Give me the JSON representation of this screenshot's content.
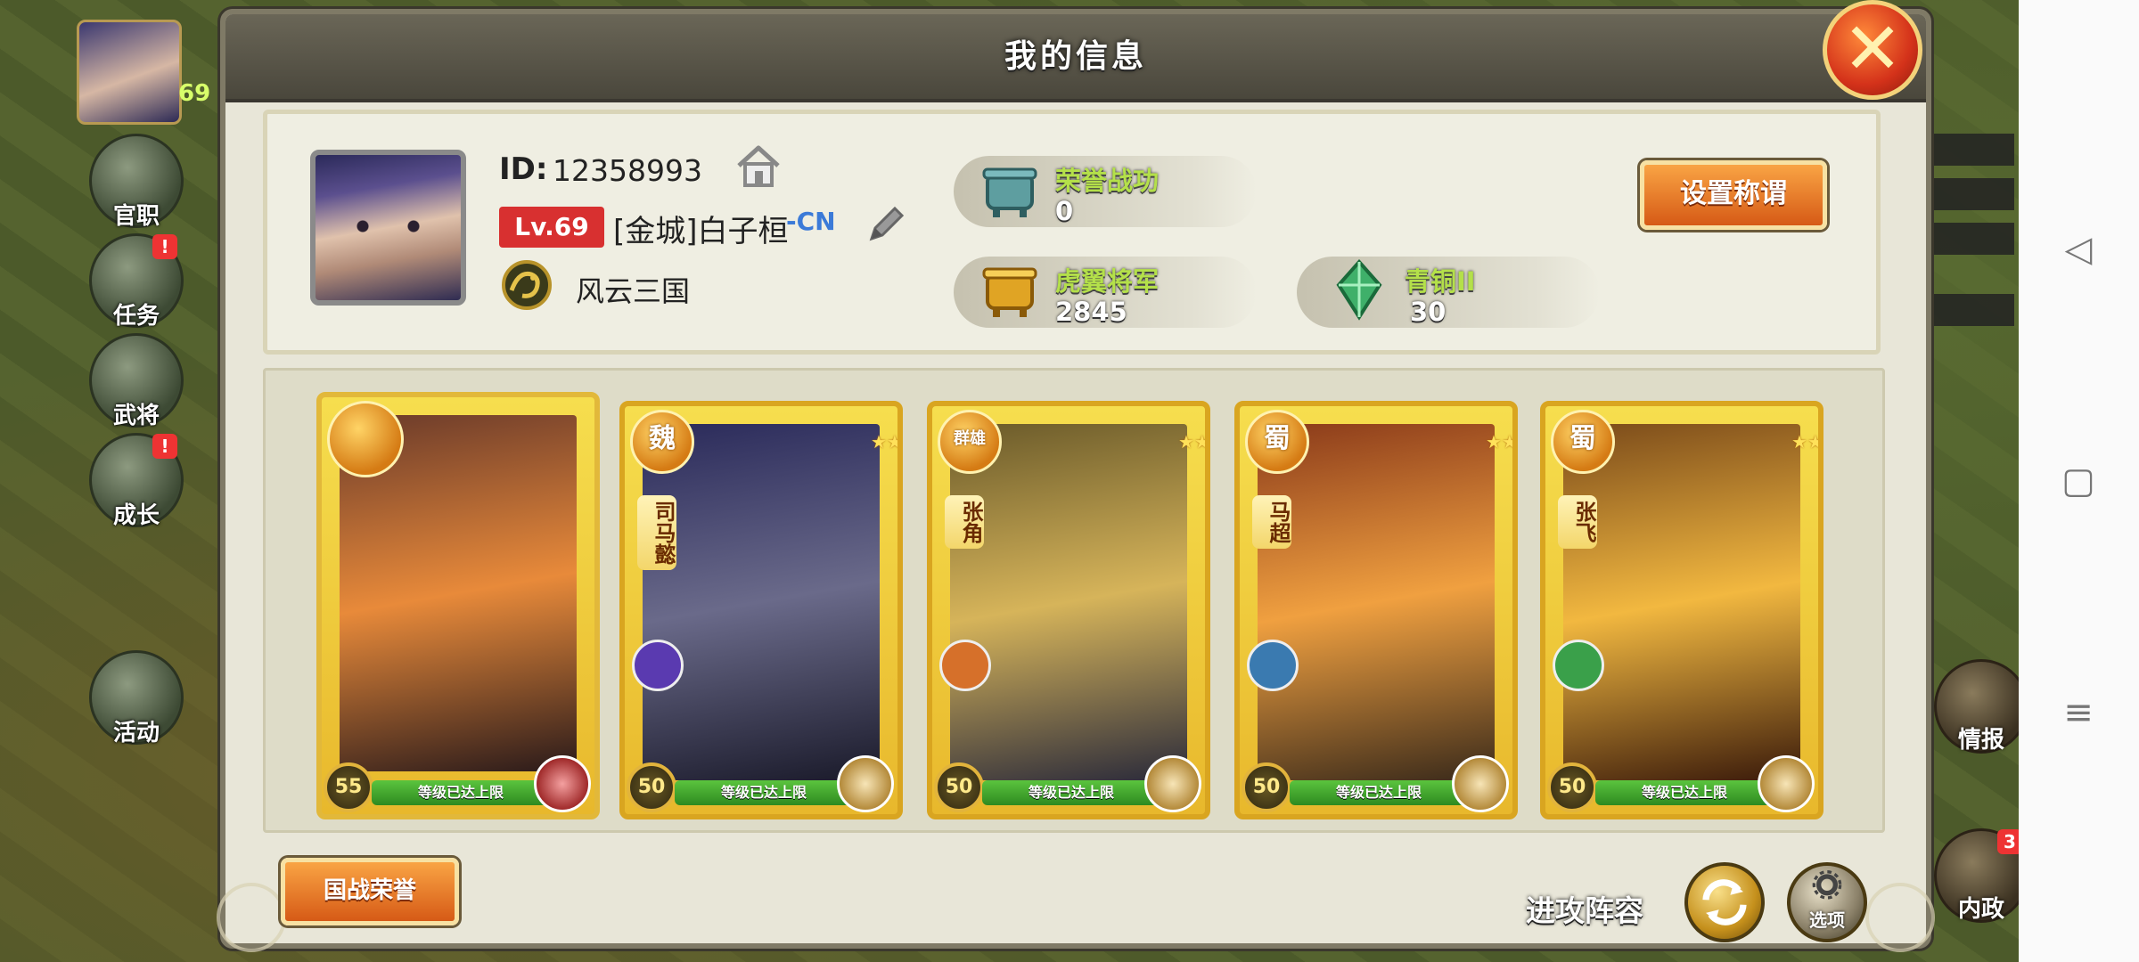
{
  "dialog": {
    "title": "我的信息",
    "close_icon": "close-x-icon"
  },
  "profile": {
    "id_label": "ID:",
    "id_value": "12358993",
    "level": "Lv.69",
    "name": "[金城]白子桓",
    "name_suffix": "-CN",
    "server": "风云三国"
  },
  "stats": {
    "honor_title": "荣誉战功",
    "honor_value": "0",
    "rank_title": "虎翼将军",
    "rank_value": "2845",
    "tier_title": "青铜II",
    "tier_value": "30"
  },
  "buttons": {
    "set_title": "设置称谓",
    "national_honor": "国战荣誉",
    "attack_lineup": "进攻阵容",
    "options": "选项"
  },
  "cards": [
    {
      "faction": "",
      "name": "",
      "level": "55",
      "status": "等级已达上限",
      "art": [
        "#6a3a2a",
        "#e88a3a",
        "#2a1a1a"
      ]
    },
    {
      "faction": "魏",
      "name": "司马懿",
      "level": "50",
      "status": "等级已达上限",
      "art": [
        "#2a2a5a",
        "#6a6a8a",
        "#1a1a2a"
      ]
    },
    {
      "faction": "群雄",
      "name": "张角",
      "level": "50",
      "status": "等级已达上限",
      "art": [
        "#6a5a2a",
        "#d6b45a",
        "#2a2a3a"
      ]
    },
    {
      "faction": "蜀",
      "name": "马超",
      "level": "50",
      "status": "等级已达上限",
      "art": [
        "#8a3a1a",
        "#f0a040",
        "#3a2a1a"
      ]
    },
    {
      "faction": "蜀",
      "name": "张飞",
      "level": "50",
      "status": "等级已达上限",
      "art": [
        "#7a4a1a",
        "#f2b840",
        "#3a1a0a"
      ]
    }
  ],
  "side_menu": {
    "level": "69",
    "items": [
      {
        "label": "官职",
        "badge": ""
      },
      {
        "label": "任务",
        "badge": "!"
      },
      {
        "label": "武将",
        "badge": ""
      },
      {
        "label": "成长",
        "badge": "!"
      },
      {
        "label": "活动",
        "badge": ""
      }
    ],
    "right_items": [
      {
        "label": "情报"
      },
      {
        "label": "内政",
        "badge": "3"
      }
    ]
  },
  "colors": {
    "accent_green": "#b4e04a",
    "button_orange": "#e8762a",
    "level_red": "#d83030"
  }
}
